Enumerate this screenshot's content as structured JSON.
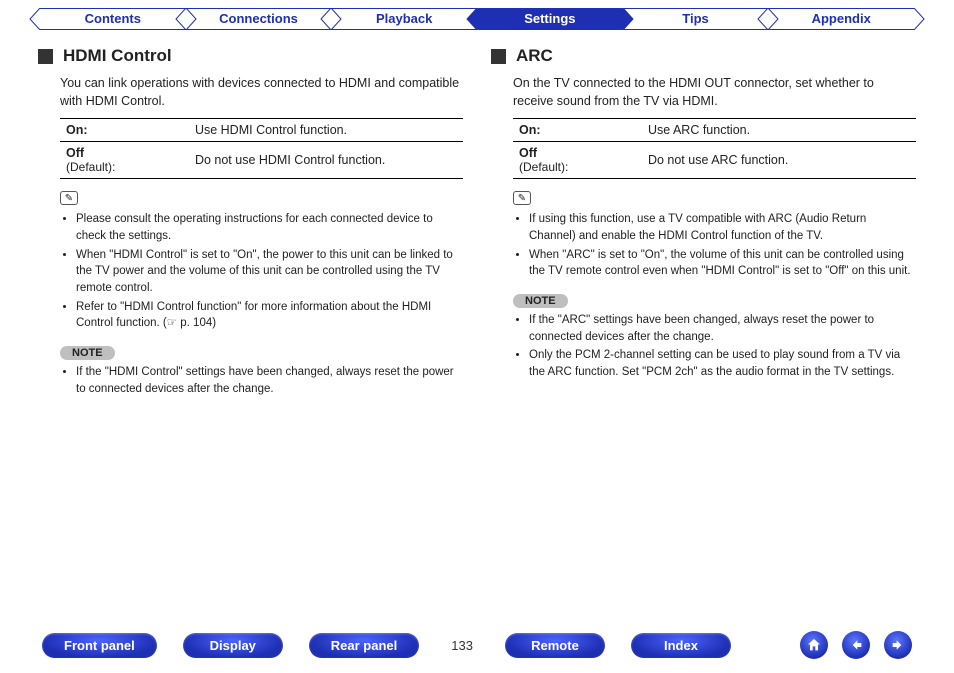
{
  "tabs": [
    {
      "label": "Contents",
      "active": false
    },
    {
      "label": "Connections",
      "active": false
    },
    {
      "label": "Playback",
      "active": false
    },
    {
      "label": "Settings",
      "active": true
    },
    {
      "label": "Tips",
      "active": false
    },
    {
      "label": "Appendix",
      "active": false
    }
  ],
  "left": {
    "heading": "HDMI Control",
    "lead": "You can link operations with devices connected to HDMI and compatible with HDMI Control.",
    "rows": [
      {
        "key": "On:",
        "sub": "",
        "val": "Use HDMI Control function."
      },
      {
        "key": "Off",
        "sub": "(Default):",
        "val": "Do not use HDMI Control function."
      }
    ],
    "tips": [
      "Please consult the operating instructions for each connected device to check the settings.",
      "When \"HDMI Control\" is set to \"On\", the power to this unit can be linked to the TV power and the volume of this unit can be controlled using the TV remote control.",
      "Refer to \"HDMI Control function\" for more information about the HDMI Control function.  (☞ p. 104)"
    ],
    "note_label": "NOTE",
    "notes": [
      "If the \"HDMI Control\" settings have been changed, always reset the power to connected devices after the change."
    ]
  },
  "right": {
    "heading": "ARC",
    "lead": "On the TV connected to the HDMI OUT connector, set whether to receive sound from the TV via HDMI.",
    "rows": [
      {
        "key": "On:",
        "sub": "",
        "val": "Use ARC function."
      },
      {
        "key": "Off",
        "sub": "(Default):",
        "val": "Do not use ARC function."
      }
    ],
    "tips": [
      "If using this function, use a TV compatible with ARC (Audio Return Channel) and enable the HDMI Control function of the TV.",
      "When \"ARC\" is set to \"On\", the volume of this unit can be controlled using the TV remote control even when \"HDMI Control\" is set to \"Off\" on this unit."
    ],
    "note_label": "NOTE",
    "notes": [
      "If the \"ARC\" settings have been changed, always reset the power to connected devices after the change.",
      "Only the PCM 2-channel setting can be used to play sound from a TV via the ARC function. Set \"PCM 2ch\" as the audio format in the TV settings."
    ]
  },
  "bottom": {
    "buttons": [
      "Front panel",
      "Display",
      "Rear panel"
    ],
    "page_number": "133",
    "buttons2": [
      "Remote",
      "Index"
    ]
  }
}
